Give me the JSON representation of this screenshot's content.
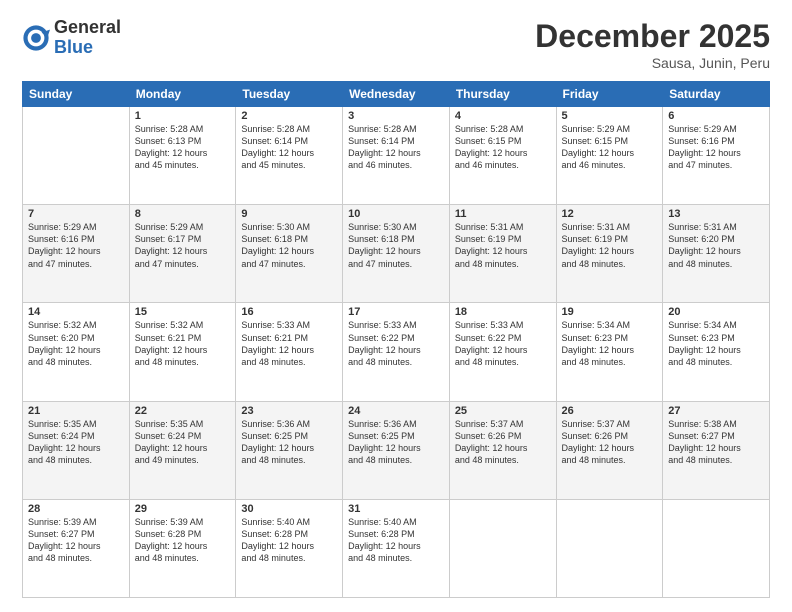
{
  "logo": {
    "general": "General",
    "blue": "Blue"
  },
  "title": "December 2025",
  "location": "Sausa, Junin, Peru",
  "headers": [
    "Sunday",
    "Monday",
    "Tuesday",
    "Wednesday",
    "Thursday",
    "Friday",
    "Saturday"
  ],
  "weeks": [
    [
      {
        "day": "",
        "info": ""
      },
      {
        "day": "1",
        "info": "Sunrise: 5:28 AM\nSunset: 6:13 PM\nDaylight: 12 hours\nand 45 minutes."
      },
      {
        "day": "2",
        "info": "Sunrise: 5:28 AM\nSunset: 6:14 PM\nDaylight: 12 hours\nand 45 minutes."
      },
      {
        "day": "3",
        "info": "Sunrise: 5:28 AM\nSunset: 6:14 PM\nDaylight: 12 hours\nand 46 minutes."
      },
      {
        "day": "4",
        "info": "Sunrise: 5:28 AM\nSunset: 6:15 PM\nDaylight: 12 hours\nand 46 minutes."
      },
      {
        "day": "5",
        "info": "Sunrise: 5:29 AM\nSunset: 6:15 PM\nDaylight: 12 hours\nand 46 minutes."
      },
      {
        "day": "6",
        "info": "Sunrise: 5:29 AM\nSunset: 6:16 PM\nDaylight: 12 hours\nand 47 minutes."
      }
    ],
    [
      {
        "day": "7",
        "info": "Sunrise: 5:29 AM\nSunset: 6:16 PM\nDaylight: 12 hours\nand 47 minutes."
      },
      {
        "day": "8",
        "info": "Sunrise: 5:29 AM\nSunset: 6:17 PM\nDaylight: 12 hours\nand 47 minutes."
      },
      {
        "day": "9",
        "info": "Sunrise: 5:30 AM\nSunset: 6:18 PM\nDaylight: 12 hours\nand 47 minutes."
      },
      {
        "day": "10",
        "info": "Sunrise: 5:30 AM\nSunset: 6:18 PM\nDaylight: 12 hours\nand 47 minutes."
      },
      {
        "day": "11",
        "info": "Sunrise: 5:31 AM\nSunset: 6:19 PM\nDaylight: 12 hours\nand 48 minutes."
      },
      {
        "day": "12",
        "info": "Sunrise: 5:31 AM\nSunset: 6:19 PM\nDaylight: 12 hours\nand 48 minutes."
      },
      {
        "day": "13",
        "info": "Sunrise: 5:31 AM\nSunset: 6:20 PM\nDaylight: 12 hours\nand 48 minutes."
      }
    ],
    [
      {
        "day": "14",
        "info": "Sunrise: 5:32 AM\nSunset: 6:20 PM\nDaylight: 12 hours\nand 48 minutes."
      },
      {
        "day": "15",
        "info": "Sunrise: 5:32 AM\nSunset: 6:21 PM\nDaylight: 12 hours\nand 48 minutes."
      },
      {
        "day": "16",
        "info": "Sunrise: 5:33 AM\nSunset: 6:21 PM\nDaylight: 12 hours\nand 48 minutes."
      },
      {
        "day": "17",
        "info": "Sunrise: 5:33 AM\nSunset: 6:22 PM\nDaylight: 12 hours\nand 48 minutes."
      },
      {
        "day": "18",
        "info": "Sunrise: 5:33 AM\nSunset: 6:22 PM\nDaylight: 12 hours\nand 48 minutes."
      },
      {
        "day": "19",
        "info": "Sunrise: 5:34 AM\nSunset: 6:23 PM\nDaylight: 12 hours\nand 48 minutes."
      },
      {
        "day": "20",
        "info": "Sunrise: 5:34 AM\nSunset: 6:23 PM\nDaylight: 12 hours\nand 48 minutes."
      }
    ],
    [
      {
        "day": "21",
        "info": "Sunrise: 5:35 AM\nSunset: 6:24 PM\nDaylight: 12 hours\nand 48 minutes."
      },
      {
        "day": "22",
        "info": "Sunrise: 5:35 AM\nSunset: 6:24 PM\nDaylight: 12 hours\nand 49 minutes."
      },
      {
        "day": "23",
        "info": "Sunrise: 5:36 AM\nSunset: 6:25 PM\nDaylight: 12 hours\nand 48 minutes."
      },
      {
        "day": "24",
        "info": "Sunrise: 5:36 AM\nSunset: 6:25 PM\nDaylight: 12 hours\nand 48 minutes."
      },
      {
        "day": "25",
        "info": "Sunrise: 5:37 AM\nSunset: 6:26 PM\nDaylight: 12 hours\nand 48 minutes."
      },
      {
        "day": "26",
        "info": "Sunrise: 5:37 AM\nSunset: 6:26 PM\nDaylight: 12 hours\nand 48 minutes."
      },
      {
        "day": "27",
        "info": "Sunrise: 5:38 AM\nSunset: 6:27 PM\nDaylight: 12 hours\nand 48 minutes."
      }
    ],
    [
      {
        "day": "28",
        "info": "Sunrise: 5:39 AM\nSunset: 6:27 PM\nDaylight: 12 hours\nand 48 minutes."
      },
      {
        "day": "29",
        "info": "Sunrise: 5:39 AM\nSunset: 6:28 PM\nDaylight: 12 hours\nand 48 minutes."
      },
      {
        "day": "30",
        "info": "Sunrise: 5:40 AM\nSunset: 6:28 PM\nDaylight: 12 hours\nand 48 minutes."
      },
      {
        "day": "31",
        "info": "Sunrise: 5:40 AM\nSunset: 6:28 PM\nDaylight: 12 hours\nand 48 minutes."
      },
      {
        "day": "",
        "info": ""
      },
      {
        "day": "",
        "info": ""
      },
      {
        "day": "",
        "info": ""
      }
    ]
  ]
}
